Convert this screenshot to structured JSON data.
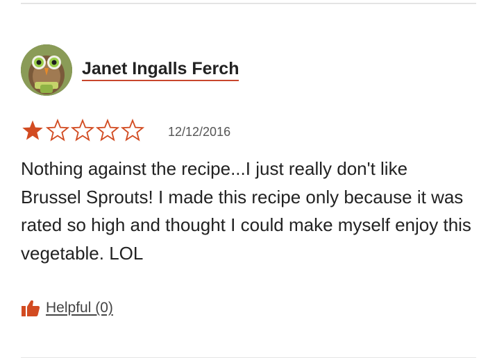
{
  "review": {
    "author": "Janet Ingalls Ferch",
    "rating": 1,
    "max_rating": 5,
    "date": "12/12/2016",
    "text": "Nothing against the recipe...I just really don't like Brussel Sprouts! I made this recipe only because it was rated so high and thought I could make myself enjoy this vegetable. LOL",
    "helpful_label": "Helpful (0)"
  },
  "colors": {
    "accent": "#c8452c",
    "star_filled": "#d24b21",
    "divider": "#e4e4e4"
  },
  "icons": {
    "avatar": "owl-photo-avatar",
    "star_filled": "star-filled-icon",
    "star_empty": "star-outline-icon",
    "helpful": "thumbs-up-icon"
  }
}
